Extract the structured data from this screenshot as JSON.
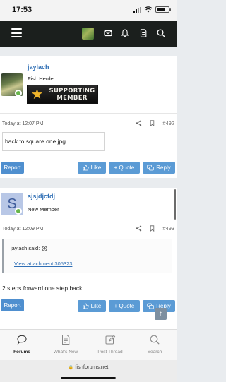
{
  "status_bar": {
    "time": "17:53"
  },
  "header": {
    "menu_icon": "hamburger-icon",
    "logo_icon": "fishforums-logo",
    "icons": [
      "mail-icon",
      "bell-icon",
      "document-icon",
      "search-icon"
    ]
  },
  "posts": [
    {
      "username": "jaylach",
      "user_title": "Fish Herder",
      "badge_line1": "SUPPORTING",
      "badge_line2": "MEMBER",
      "timestamp": "Today at 12:07 PM",
      "post_number": "#492",
      "attachment_text": "back to square one.jpg",
      "buttons": {
        "report": "Report",
        "like": "Like",
        "quote": "+ Quote",
        "reply": "Reply"
      }
    },
    {
      "username": "sjsjdjcfdj",
      "avatar_letter": "S",
      "user_title": "New Member",
      "timestamp": "Today at 12:09 PM",
      "post_number": "#493",
      "quote_author": "jaylach said:",
      "quote_link": "View attachment 305323",
      "body": "2 steps forward one step back",
      "buttons": {
        "report": "Report",
        "like": "Like",
        "quote": "+ Quote",
        "reply": "Reply"
      }
    }
  ],
  "tabbar": [
    {
      "label": "Forums",
      "icon": "chat-bubble-icon",
      "active": true
    },
    {
      "label": "What's New",
      "icon": "document-icon",
      "active": false
    },
    {
      "label": "Post Thread",
      "icon": "edit-icon",
      "active": false
    },
    {
      "label": "Search",
      "icon": "search-icon",
      "active": false
    }
  ],
  "browser": {
    "url": "fishforums.net"
  },
  "colors": {
    "link": "#2f6fb5",
    "button": "#5b9bd5",
    "header": "#1b1f1d",
    "online": "#68b64b"
  }
}
